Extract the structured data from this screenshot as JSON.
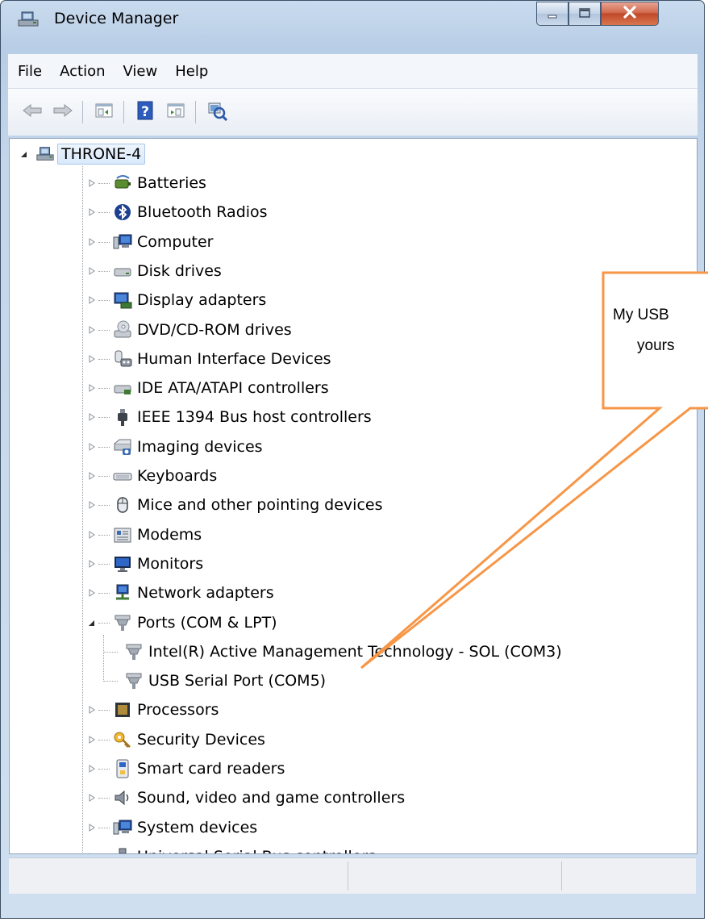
{
  "window": {
    "title": "Device Manager"
  },
  "caption_buttons": [
    "minimize-icon",
    "maximize-icon",
    "close-icon"
  ],
  "menu": [
    "File",
    "Action",
    "View",
    "Help"
  ],
  "toolbar": {
    "buttons": [
      "back-arrow-icon",
      "forward-arrow-icon",
      "show-hide-console-tree-icon",
      "help-icon",
      "properties-icon",
      "scan-hardware-changes-icon"
    ]
  },
  "tree": {
    "root": {
      "label": "THRONE-4",
      "expanded": true
    },
    "categories": [
      {
        "label": "Batteries",
        "icon": "batteries-icon"
      },
      {
        "label": "Bluetooth Radios",
        "icon": "bluetooth-icon"
      },
      {
        "label": "Computer",
        "icon": "computer-icon"
      },
      {
        "label": "Disk drives",
        "icon": "disk-drive-icon"
      },
      {
        "label": "Display adapters",
        "icon": "display-adapter-icon"
      },
      {
        "label": "DVD/CD-ROM drives",
        "icon": "dvd-drive-icon"
      },
      {
        "label": "Human Interface Devices",
        "icon": "hid-icon"
      },
      {
        "label": "IDE ATA/ATAPI controllers",
        "icon": "ide-controller-icon"
      },
      {
        "label": "IEEE 1394 Bus host controllers",
        "icon": "ieee1394-icon"
      },
      {
        "label": "Imaging devices",
        "icon": "imaging-device-icon"
      },
      {
        "label": "Keyboards",
        "icon": "keyboard-icon"
      },
      {
        "label": "Mice and other pointing devices",
        "icon": "mouse-icon"
      },
      {
        "label": "Modems",
        "icon": "modem-icon"
      },
      {
        "label": "Monitors",
        "icon": "monitor-icon"
      },
      {
        "label": "Network adapters",
        "icon": "network-adapter-icon"
      },
      {
        "label": "Ports (COM & LPT)",
        "icon": "port-icon",
        "expanded": true,
        "children": [
          {
            "label": "Intel(R) Active Management Technology - SOL (COM3)",
            "icon": "port-icon"
          },
          {
            "label": "USB Serial Port (COM5)",
            "icon": "port-icon"
          }
        ]
      },
      {
        "label": "Processors",
        "icon": "processor-icon"
      },
      {
        "label": "Security Devices",
        "icon": "security-key-icon"
      },
      {
        "label": "Smart card readers",
        "icon": "smart-card-reader-icon"
      },
      {
        "label": "Sound, video and game controllers",
        "icon": "speaker-icon"
      },
      {
        "label": "System devices",
        "icon": "system-devices-icon"
      },
      {
        "label": "Universal Serial Bus controllers",
        "icon": "usb-icon"
      }
    ]
  },
  "callout": {
    "lines": [
      "My USB",
      "yours"
    ],
    "color": "#f79646"
  }
}
